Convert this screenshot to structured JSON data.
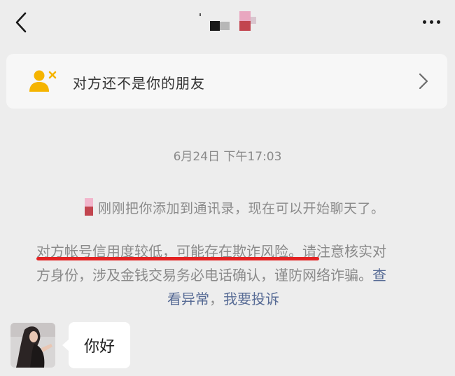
{
  "header": {
    "title": "",
    "back_icon": "chevron-left-icon",
    "more_icon": "more-dots-icon"
  },
  "banner": {
    "text": "对方还不是你的朋友",
    "icon": "add-friend-icon",
    "icon_color": "#f5b400",
    "chevron_icon": "chevron-right-icon"
  },
  "chat": {
    "timestamp": "6月24日 下午17:03",
    "system_message": "刚刚把你添加到通讯录，现在可以开始聊天了。",
    "warning": {
      "risk_text": "对方帐号信用度较低，可能存在欺诈风险",
      "after_risk": "。请注意核实对",
      "line2": "方身份，涉及金钱交易务必电话确认，谨防网络诈骗。",
      "link_part1": "查",
      "link_part2": "看异常",
      "separator": "，",
      "link_report": "我要投诉"
    },
    "messages": [
      {
        "text": "你好",
        "from": "other"
      }
    ]
  },
  "colors": {
    "link": "#576b95",
    "underline": "#e32222",
    "background": "#ededed"
  }
}
